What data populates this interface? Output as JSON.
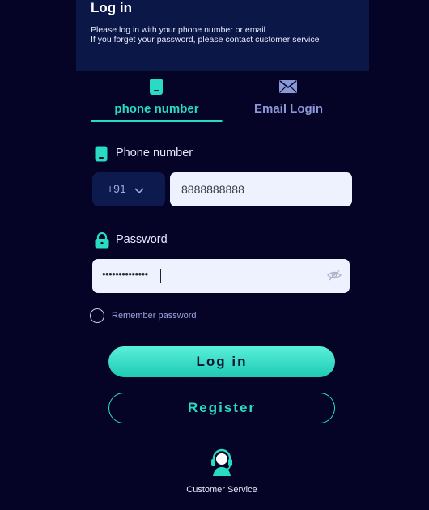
{
  "header": {
    "title": "Log in",
    "line1": "Please log in with your phone number or email",
    "line2": "If you forget your password, please contact customer service"
  },
  "tabs": [
    {
      "label": "phone number",
      "active": true,
      "icon": "phone-icon"
    },
    {
      "label": "Email Login",
      "active": false,
      "icon": "mail-icon"
    }
  ],
  "phone_field": {
    "label": "Phone number",
    "country_code": "+91",
    "value": "8888888888"
  },
  "password_field": {
    "label": "Password",
    "masked_value": "••••••••••••••",
    "toggle_icon": "eye-off-icon"
  },
  "remember": {
    "label": "Remember password",
    "checked": false
  },
  "buttons": {
    "login": "Log in",
    "register": "Register"
  },
  "customer_service": {
    "label": "Customer Service",
    "icon": "headset-agent-icon"
  },
  "colors": {
    "background": "#050426",
    "header_bg": "#0a1747",
    "accent": "#27dcc3",
    "inactive_tab": "#8a98d6",
    "input_bg": "#eef2ff"
  }
}
